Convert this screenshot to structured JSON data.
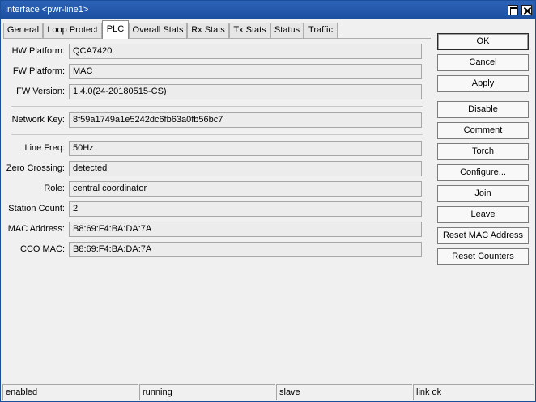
{
  "window": {
    "title": "Interface <pwr-line1>"
  },
  "tabs": [
    {
      "label": "General"
    },
    {
      "label": "Loop Protect"
    },
    {
      "label": "PLC",
      "active": true
    },
    {
      "label": "Overall Stats"
    },
    {
      "label": "Rx Stats"
    },
    {
      "label": "Tx Stats"
    },
    {
      "label": "Status"
    },
    {
      "label": "Traffic"
    }
  ],
  "fields": {
    "hw_platform": {
      "label": "HW Platform:",
      "value": "QCA7420"
    },
    "fw_platform": {
      "label": "FW Platform:",
      "value": "MAC"
    },
    "fw_version": {
      "label": "FW Version:",
      "value": "1.4.0(24-20180515-CS)"
    },
    "network_key": {
      "label": "Network Key:",
      "value": "8f59a1749a1e5242dc6fb63a0fb56bc7"
    },
    "line_freq": {
      "label": "Line Freq:",
      "value": "50Hz"
    },
    "zero_crossing": {
      "label": "Zero Crossing:",
      "value": "detected"
    },
    "role": {
      "label": "Role:",
      "value": "central coordinator"
    },
    "station_count": {
      "label": "Station Count:",
      "value": "2"
    },
    "mac_address": {
      "label": "MAC Address:",
      "value": "B8:69:F4:BA:DA:7A"
    },
    "cco_mac": {
      "label": "CCO MAC:",
      "value": "B8:69:F4:BA:DA:7A"
    }
  },
  "buttons": {
    "ok": "OK",
    "cancel": "Cancel",
    "apply": "Apply",
    "disable": "Disable",
    "comment": "Comment",
    "torch": "Torch",
    "configure": "Configure...",
    "join": "Join",
    "leave": "Leave",
    "reset_mac": "Reset MAC Address",
    "reset_counters": "Reset Counters"
  },
  "status_bar": [
    "enabled",
    "running",
    "slave",
    "link ok"
  ],
  "colors": {
    "titlebar": "#1f56a8",
    "window_bg": "#f0f0f0"
  },
  "icons": {
    "maximize": "maximize-icon",
    "close": "close-icon"
  }
}
